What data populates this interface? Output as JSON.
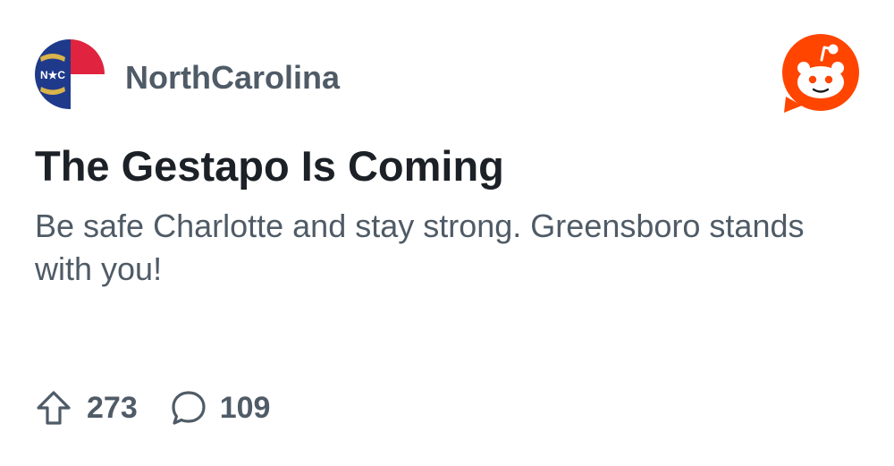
{
  "post": {
    "subreddit": "NorthCarolina",
    "avatar_icon": "north-carolina-flag-icon",
    "avatar_text": "N★C",
    "title": "The Gestapo Is Coming",
    "body": "Be safe Charlotte and stay strong. Greensboro stands with you!",
    "upvotes": "273",
    "comments": "109"
  },
  "icons": {
    "brand": "reddit-logo-icon",
    "upvote": "upvote-arrow-icon",
    "comment": "comment-bubble-icon"
  },
  "colors": {
    "reddit_orange": "#ff4500",
    "flag_blue": "#1f3a8a",
    "flag_red": "#e0233e",
    "flag_gold": "#d9b44a",
    "text_dark": "#1c2127",
    "text_muted": "#4f5b66"
  }
}
